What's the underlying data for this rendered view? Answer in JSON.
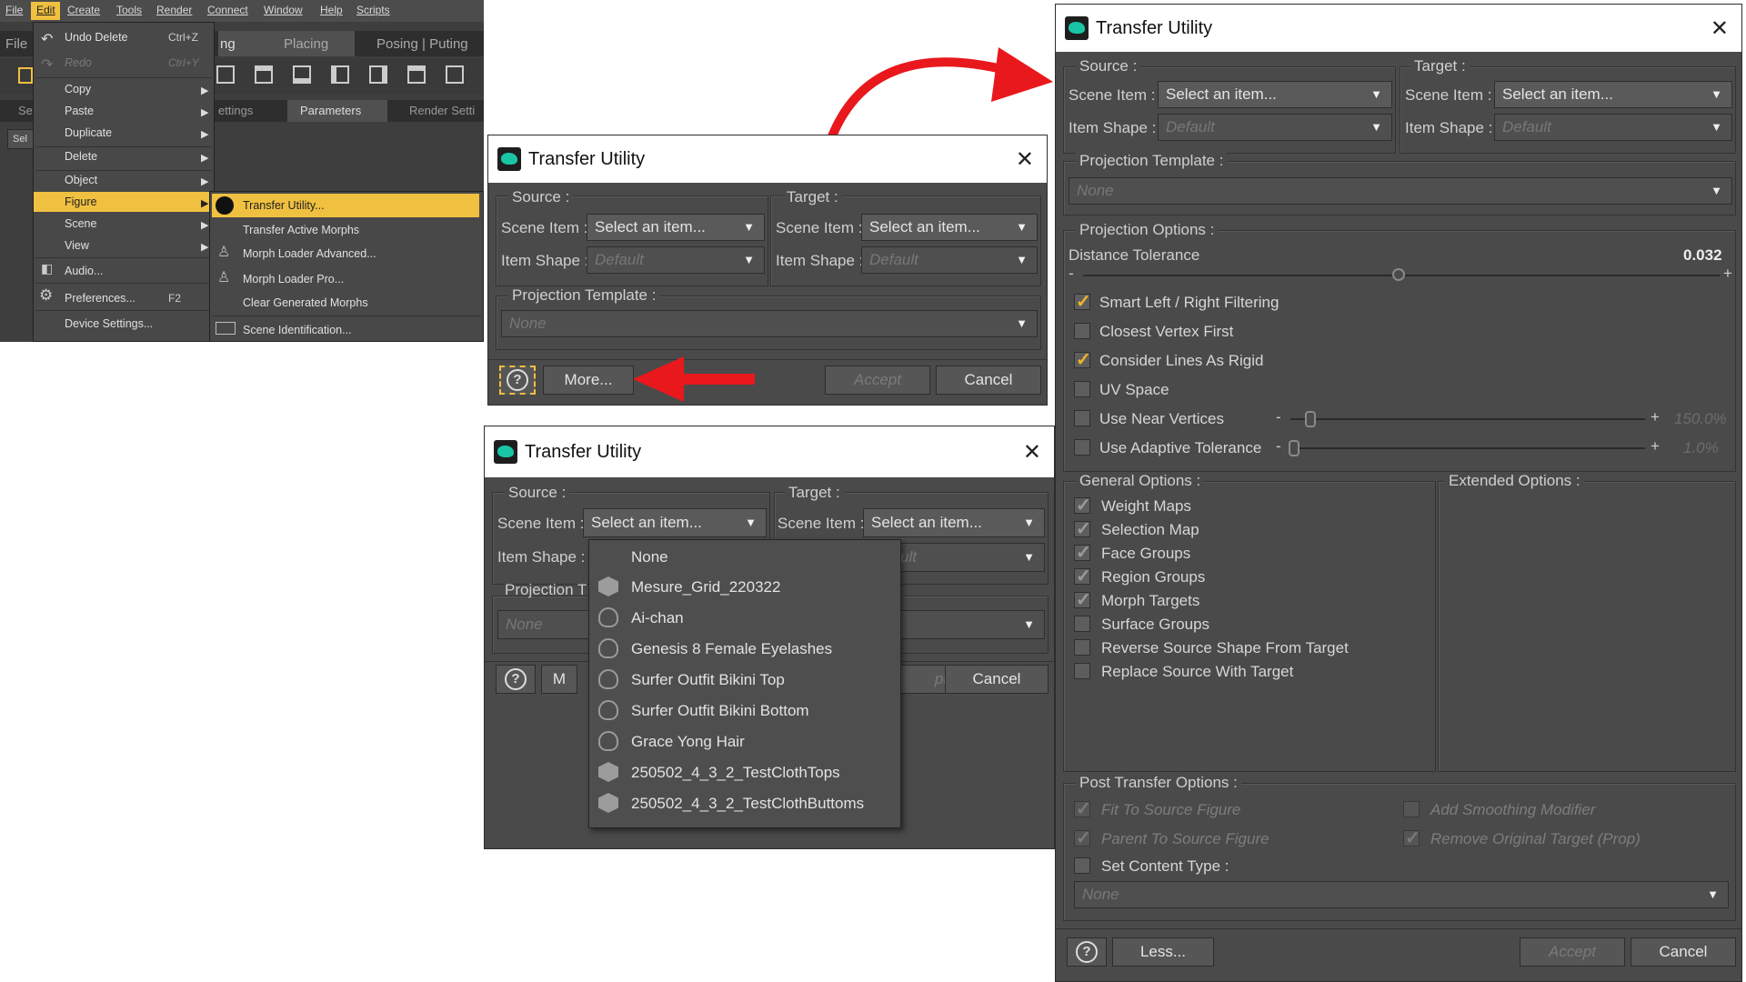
{
  "menubar": {
    "items": [
      "File",
      "Edit",
      "Create",
      "Tools",
      "Render",
      "Connect",
      "Window",
      "Help",
      "Scripts"
    ]
  },
  "app_tabs": {
    "row1": [
      "File",
      "ng",
      "Placing",
      "Posing | Puting"
    ],
    "row3": [
      "Se",
      "ettings",
      "Parameters",
      "Render Setti"
    ],
    "row4": [
      "Sel"
    ]
  },
  "edit_menu": [
    {
      "label": "Undo Delete",
      "shortcut": "Ctrl+Z"
    },
    {
      "label": "Redo",
      "shortcut": "Ctrl+Y",
      "disabled": true
    },
    {
      "label": "Copy"
    },
    {
      "label": "Paste"
    },
    {
      "label": "Duplicate"
    },
    {
      "label": "Delete"
    },
    {
      "label": "Object"
    },
    {
      "label": "Figure"
    },
    {
      "label": "Scene"
    },
    {
      "label": "View"
    },
    {
      "label": "Audio..."
    },
    {
      "label": "Preferences...",
      "shortcut": "F2"
    },
    {
      "label": "Device Settings..."
    }
  ],
  "figure_submenu": [
    "Transfer Utility...",
    "Transfer Active Morphs",
    "Morph Loader Advanced...",
    "Morph Loader Pro...",
    "Clear Generated Morphs",
    "Scene Identification..."
  ],
  "dialog_title": "Transfer Utility",
  "close_glyph": "✕",
  "source_label": "Source :",
  "target_label": "Target :",
  "scene_item_label": "Scene Item :",
  "item_shape_label": "Item Shape :",
  "select_item": "Select an item...",
  "default_value": "Default",
  "projection_template_label": "Projection Template :",
  "none_value": "None",
  "more_button": "More...",
  "less_button": "Less...",
  "accept_button": "Accept",
  "cancel_button": "Cancel",
  "help_glyph": "?",
  "dropdown_list": [
    {
      "label": "None",
      "icon": ""
    },
    {
      "label": "Mesure_Grid_220322",
      "icon": "cube-icon"
    },
    {
      "label": "Ai-chan",
      "icon": "figure-icon"
    },
    {
      "label": "Genesis 8 Female Eyelashes",
      "icon": "figure-icon"
    },
    {
      "label": "Surfer Outfit Bikini Top",
      "icon": "figure-icon"
    },
    {
      "label": "Surfer Outfit Bikini Bottom",
      "icon": "figure-icon"
    },
    {
      "label": "Grace Yong Hair",
      "icon": "figure-icon"
    },
    {
      "label": "250502_4_3_2_TestClothTops",
      "icon": "cube-icon"
    },
    {
      "label": "250502_4_3_2_TestClothButtoms",
      "icon": "cube-icon"
    }
  ],
  "partial": {
    "projection_t": "Projection T",
    "m": "M",
    "ult": "ult",
    "pt": "pt"
  },
  "projection_options": {
    "label": "Projection Options :",
    "distance_tolerance": {
      "label": "Distance Tolerance",
      "value": "0.032",
      "position": 0.72
    },
    "checks": [
      {
        "label": "Smart Left / Right Filtering",
        "checked": true
      },
      {
        "label": "Closest Vertex First",
        "checked": false
      },
      {
        "label": "Consider Lines As Rigid",
        "checked": true
      },
      {
        "label": "UV Space",
        "checked": false
      },
      {
        "label": "Use Near Vertices",
        "checked": false,
        "slider_value": "150.0%",
        "position": 0.05
      },
      {
        "label": "Use Adaptive Tolerance",
        "checked": false,
        "slider_value": "1.0%",
        "position": 0.0
      }
    ],
    "minus": "-",
    "plus": "+"
  },
  "general_options": {
    "label": "General Options :",
    "items": [
      {
        "label": "Weight Maps",
        "checked": true
      },
      {
        "label": "Selection Map",
        "checked": true
      },
      {
        "label": "Face Groups",
        "checked": true
      },
      {
        "label": "Region Groups",
        "checked": true
      },
      {
        "label": "Morph Targets",
        "checked": true
      },
      {
        "label": "Surface Groups",
        "checked": false
      },
      {
        "label": "Reverse Source Shape From Target",
        "checked": false
      },
      {
        "label": "Replace Source With Target",
        "checked": false
      }
    ]
  },
  "extended_options_label": "Extended Options :",
  "post_transfer": {
    "label": "Post Transfer Options :",
    "fit_to_source": "Fit To Source Figure",
    "parent_to_source": "Parent To Source Figure",
    "add_smoothing": "Add Smoothing Modifier",
    "remove_original": "Remove Original Target (Prop)",
    "set_content_type": "Set Content Type :"
  },
  "colors": {
    "accent": "#f0c040",
    "arrow": "#e8181c",
    "panel": "#4a4a4a",
    "teal": "#19c5a5"
  }
}
